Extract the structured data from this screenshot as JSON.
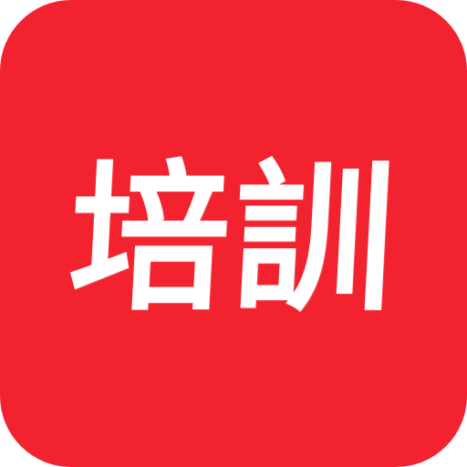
{
  "icon": {
    "label": "培訓",
    "background_color": "#f2232f",
    "text_color": "#ffffff"
  }
}
